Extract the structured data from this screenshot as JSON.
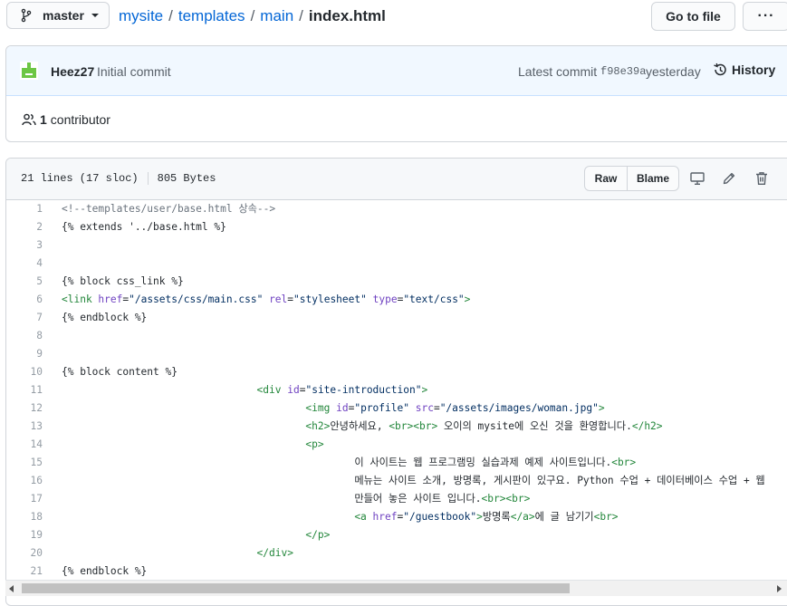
{
  "branch": {
    "label": "master"
  },
  "breadcrumb": {
    "repo": "mysite",
    "sep": "/",
    "dir1": "templates",
    "dir2": "main",
    "file": "index.html"
  },
  "actions": {
    "goto_file": "Go to file",
    "more": "···"
  },
  "commit": {
    "author": "Heez27",
    "message": "Initial commit",
    "latest_label": "Latest commit",
    "sha": "f98e39a",
    "when": "yesterday",
    "history": "History",
    "contributors_count": "1",
    "contributors_label": "contributor"
  },
  "file": {
    "lines_info": "21 lines (17 sloc)",
    "size": "805 Bytes",
    "raw": "Raw",
    "blame": "Blame"
  },
  "colors": {
    "link": "#0366d6",
    "header_bg": "#f1f8ff",
    "tag": "#22863a",
    "attr": "#6f42c1",
    "string": "#032f62",
    "comment": "#6a737d"
  },
  "code": {
    "l1": "1",
    "l2": "2",
    "l3": "3",
    "l4": "4",
    "l5": "5",
    "l6": "6",
    "l7": "7",
    "l8": "8",
    "l9": "9",
    "l10": "10",
    "l11": "11",
    "l12": "12",
    "l13": "13",
    "l14": "14",
    "l15": "15",
    "l16": "16",
    "l17": "17",
    "l18": "18",
    "l19": "19",
    "l20": "20",
    "l21": "21",
    "c1": "<!--templates/user/base.html 상속-->",
    "c2": "{% extends '../base.html %}",
    "c5": "{% block css_link %}",
    "c6_a": "<link ",
    "c6_b": "href",
    "c6_c": "=",
    "c6_d": "\"/assets/css/main.css\"",
    "c6_e": " ",
    "c6_f": "rel",
    "c6_g": "=",
    "c6_h": "\"stylesheet\"",
    "c6_i": " ",
    "c6_j": "type",
    "c6_k": "=",
    "c6_l": "\"text/css\"",
    "c6_m": ">",
    "c7": "{% endblock %}",
    "c10": "{% block content %}",
    "c11_indent": "                                ",
    "c11_a": "<div ",
    "c11_b": "id",
    "c11_c": "=",
    "c11_d": "\"site-introduction\"",
    "c11_e": ">",
    "c12_indent": "                                        ",
    "c12_a": "<img ",
    "c12_b": "id",
    "c12_c": "=",
    "c12_d": "\"profile\"",
    "c12_e": " ",
    "c12_f": "src",
    "c12_g": "=",
    "c12_h": "\"/assets/images/woman.jpg\"",
    "c12_i": ">",
    "c13_indent": "                                        ",
    "c13_a": "<h2>",
    "c13_b": "안녕하세요, ",
    "c13_c": "<br><br>",
    "c13_d": " 오이의 mysite에 오신 것을 환영합니다.",
    "c13_e": "</h2>",
    "c14_indent": "                                        ",
    "c14_a": "<p>",
    "c15_indent": "                                                ",
    "c15_a": "이 사이트는 웹 프로그램밍 실습과제 예제 사이트입니다.",
    "c15_b": "<br>",
    "c16_indent": "                                                ",
    "c16_a": "메뉴는 사이트 소개, 방명록, 게시판이 있구요. Python 수업 + 데이터베이스 수업 + 웹",
    "c17_indent": "                                                ",
    "c17_a": "만들어 놓은 사이트 입니다.",
    "c17_b": "<br><br>",
    "c18_indent": "                                                ",
    "c18_a": "<a ",
    "c18_b": "href",
    "c18_c": "=",
    "c18_d": "\"/guestbook\"",
    "c18_e": ">",
    "c18_f": "방명록",
    "c18_g": "</a>",
    "c18_h": "에 글 남기기",
    "c18_i": "<br>",
    "c19_indent": "                                        ",
    "c19_a": "</p>",
    "c20_indent": "                                ",
    "c20_a": "</div>",
    "c21": "{% endblock %}"
  }
}
